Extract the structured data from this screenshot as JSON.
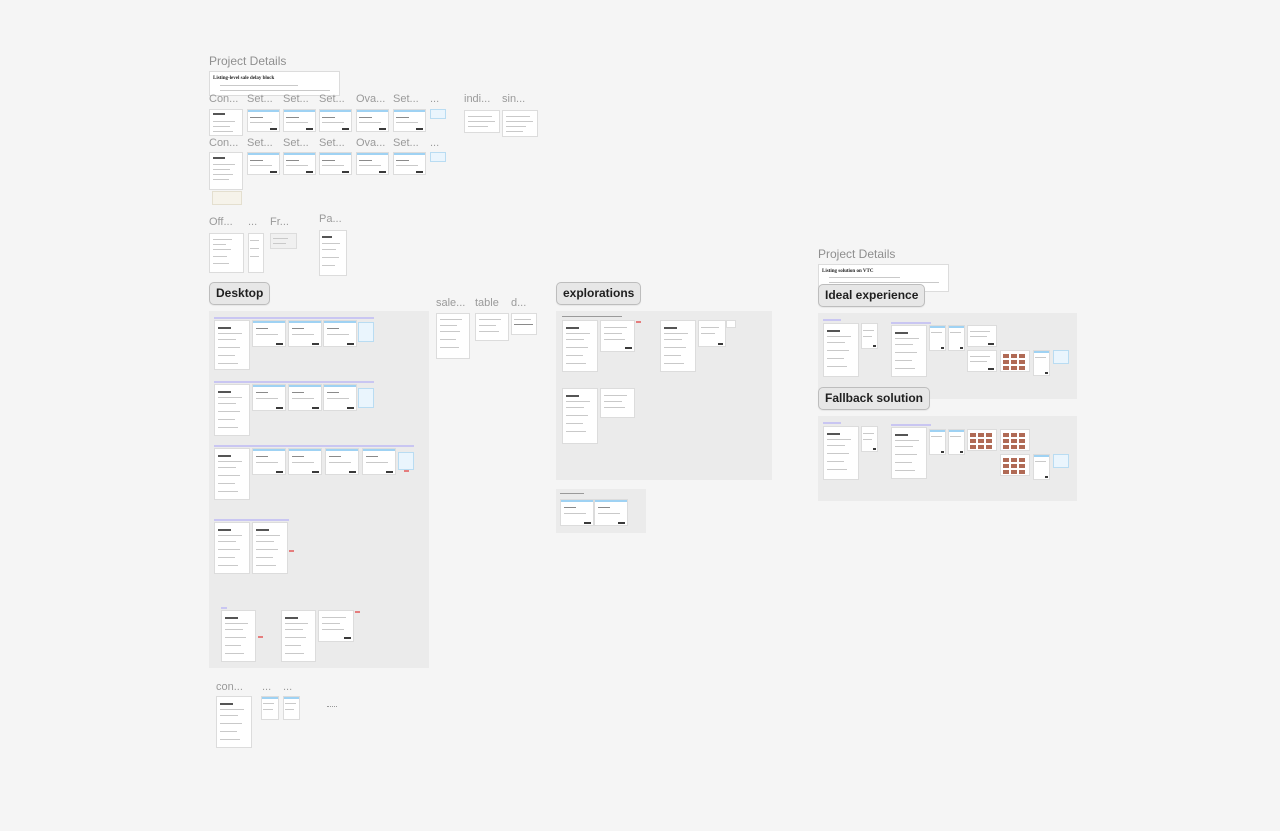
{
  "canvas": {
    "background": "#f5f5f5",
    "accent_stripe": "#9fd2f3"
  },
  "top_left": {
    "project_details_label": "Project Details",
    "doc_title": "Listing-level sale delay block",
    "row1_labels": [
      "Con...",
      "Set...",
      "Set...",
      "Set...",
      "Ova...",
      "Set...",
      "...",
      "indi...",
      "sin..."
    ],
    "row2_labels": [
      "Con...",
      "Set...",
      "Set...",
      "Set...",
      "Ova...",
      "Set...",
      "..."
    ],
    "row3_labels": [
      "Off...",
      "...",
      "Fr...",
      "Pa..."
    ]
  },
  "desktop": {
    "title": "Desktop"
  },
  "side_labels": [
    "sale...",
    "table",
    "d..."
  ],
  "explorations": {
    "title": "explorations"
  },
  "bottom_labels": [
    "con...",
    "...",
    "..."
  ],
  "right": {
    "project_details_label": "Project Details",
    "doc_title": "Listing solution on VTC",
    "ideal_title": "Ideal experience",
    "fallback_title": "Fallback solution"
  }
}
